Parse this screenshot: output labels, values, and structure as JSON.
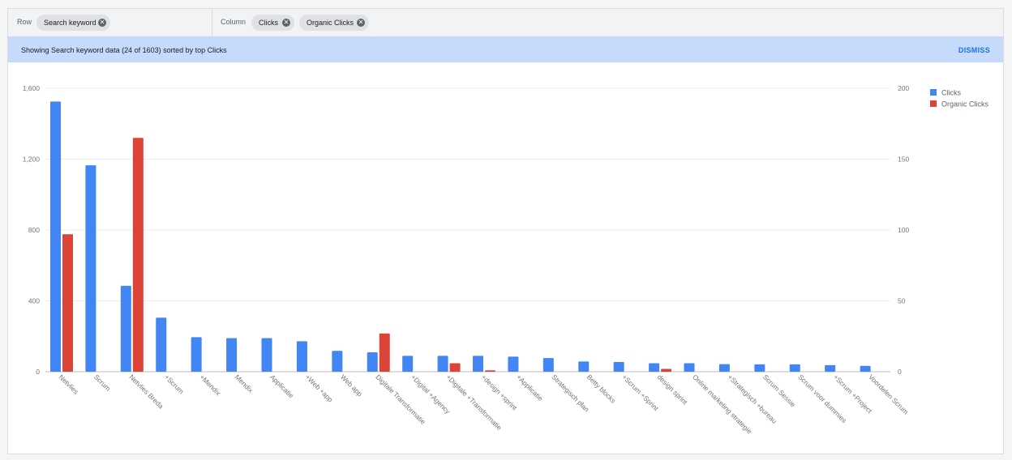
{
  "pivot": {
    "row_label": "Row",
    "row_chip": "Search keyword",
    "column_label": "Column",
    "column_chips": [
      "Clicks",
      "Organic Clicks"
    ]
  },
  "banner": {
    "text": "Showing Search keyword data (24 of 1603) sorted by top Clicks",
    "dismiss": "DISMISS"
  },
  "colors": {
    "clicks": "#4285f4",
    "organic": "#db4437",
    "banner": "#c6dafc",
    "accent": "#1a73e8"
  },
  "chart_data": {
    "type": "bar",
    "categories": [
      "Netvlies",
      "Scrum",
      "Netvlies Breda",
      "+Scrum",
      "+Mendix",
      "Mendix",
      "Applicatie",
      "+Web +app",
      "Web app",
      "Digitale Transformatie",
      "+Digital +Agency",
      "+Digitale +Transformatie",
      "+design +sprint",
      "+Applicatie",
      "Strategisch plan",
      "Betty blocks",
      "+Scrum +Sprint",
      "design sprint",
      "Online marketing strategie",
      "+Strategisch +bureau",
      "Scrum Sessie",
      "Scrum voor dummies",
      "+Scrum +Project",
      "Voordelen Scrum"
    ],
    "series": [
      {
        "name": "Clicks",
        "axis": "left",
        "values": [
          1525,
          1165,
          485,
          305,
          195,
          190,
          190,
          172,
          118,
          110,
          90,
          90,
          90,
          85,
          77,
          58,
          55,
          48,
          48,
          43,
          42,
          42,
          37,
          33
        ]
      },
      {
        "name": "Organic Clicks",
        "axis": "right",
        "values": [
          97,
          null,
          165,
          null,
          null,
          null,
          null,
          null,
          null,
          27,
          null,
          6,
          1,
          null,
          null,
          null,
          null,
          2,
          null,
          null,
          null,
          null,
          null,
          null
        ]
      }
    ],
    "left_axis": {
      "ticks": [
        "0",
        "400",
        "800",
        "1,200",
        "1,600"
      ],
      "ylim": [
        0,
        1600
      ]
    },
    "right_axis": {
      "ticks": [
        "0",
        "50",
        "100",
        "150",
        "200"
      ],
      "ylim": [
        0,
        200
      ]
    },
    "legend": {
      "position": "right",
      "entries": [
        "Clicks",
        "Organic Clicks"
      ]
    },
    "grid": true
  }
}
